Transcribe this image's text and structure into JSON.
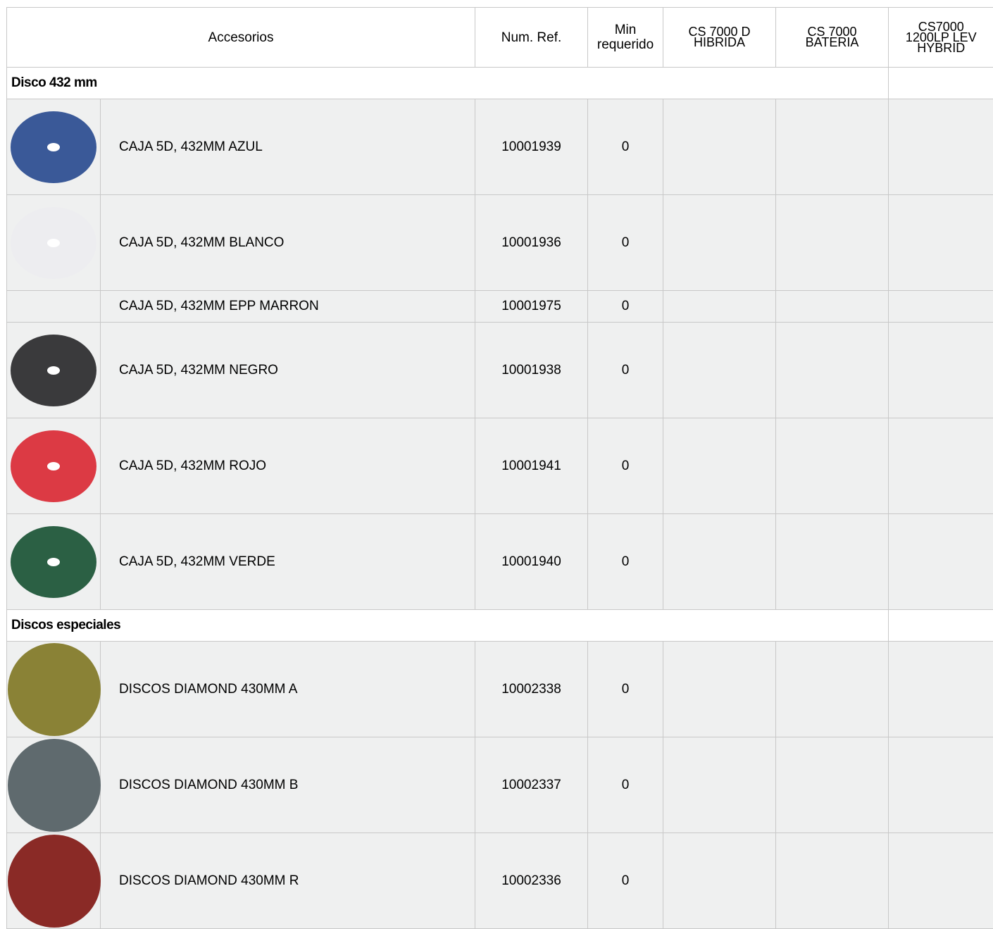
{
  "header": {
    "accesorios": "Accesorios",
    "num_ref": "Num. Ref.",
    "min_line1": "Min",
    "min_line2": "requerido",
    "col1_line1": "CS 7000 D",
    "col1_line2": "HIBRIDA",
    "col2_line1": "CS 7000",
    "col2_line2": "BATERIA",
    "col3_line1": "CS7000",
    "col3_line2": "1200LP LEV",
    "col3_line3": "HYBRID"
  },
  "sections": [
    {
      "title": "Disco 432 mm",
      "items": [
        {
          "name": "CAJA 5D, 432MM AZUL",
          "ref": "10001939",
          "min": "0",
          "disc_color": "#3a5998",
          "disc_icon": "blue-pad-icon"
        },
        {
          "name": "CAJA 5D, 432MM BLANCO",
          "ref": "10001936",
          "min": "0",
          "disc_color": "#ededf0",
          "disc_icon": "white-pad-icon"
        },
        {
          "name": "CAJA 5D, 432MM EPP MARRON",
          "ref": "10001975",
          "min": "0"
        },
        {
          "name": "CAJA 5D, 432MM NEGRO",
          "ref": "10001938",
          "min": "0",
          "disc_color": "#3a3a3c",
          "disc_icon": "black-pad-icon"
        },
        {
          "name": "CAJA 5D, 432MM ROJO",
          "ref": "10001941",
          "min": "0",
          "disc_color": "#dc3a44",
          "disc_icon": "red-pad-icon"
        },
        {
          "name": "CAJA 5D, 432MM VERDE",
          "ref": "10001940",
          "min": "0",
          "disc_color": "#2b6044",
          "disc_icon": "green-pad-icon"
        }
      ]
    },
    {
      "title": "Discos especiales",
      "items": [
        {
          "name": "DISCOS DIAMOND 430MM A",
          "ref": "10002338",
          "min": "0",
          "disc_color": "#8a8236",
          "disc_icon": "diamond-pad-a-icon"
        },
        {
          "name": "DISCOS DIAMOND 430MM B",
          "ref": "10002337",
          "min": "0",
          "disc_color": "#5f6a6e",
          "disc_icon": "diamond-pad-b-icon"
        },
        {
          "name": "DISCOS DIAMOND 430MM R",
          "ref": "10002336",
          "min": "0",
          "disc_color": "#8a2a26",
          "disc_icon": "diamond-pad-r-icon"
        }
      ]
    }
  ]
}
